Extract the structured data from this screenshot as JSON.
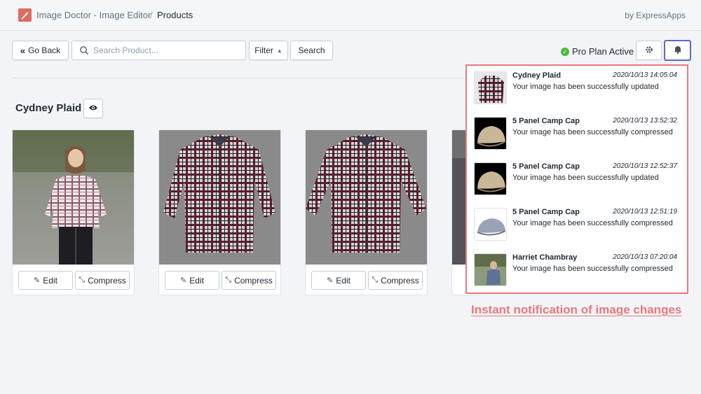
{
  "header": {
    "app_name": "Image Doctor - Image Editor",
    "separator": "/",
    "page": "Products",
    "by": "by ExpressApps"
  },
  "toolbar": {
    "go_back_label": "Go Back",
    "search_placeholder": "Search Product...",
    "search_value": "",
    "filter_label": "Filter",
    "search_button_label": "Search",
    "plan_status": "Pro Plan Active"
  },
  "product": {
    "title": "Cydney Plaid",
    "cards": [
      {
        "edit_label": "Edit",
        "compress_label": "Compress"
      },
      {
        "edit_label": "Edit",
        "compress_label": "Compress"
      },
      {
        "edit_label": "Edit",
        "compress_label": "Compress"
      }
    ]
  },
  "notifications": [
    {
      "name": "Cydney Plaid",
      "time": "2020/10/13 14:05:04",
      "message": "Your image has been successfully updated"
    },
    {
      "name": "5 Panel Camp Cap",
      "time": "2020/10/13 13:52:32",
      "message": "Your image has been successfully compressed"
    },
    {
      "name": "5 Panel Camp Cap",
      "time": "2020/10/13 12:52:37",
      "message": "Your image has been successfully updated"
    },
    {
      "name": "5 Panel Camp Cap",
      "time": "2020/10/13 12:51:19",
      "message": "Your image has been successfully compressed"
    },
    {
      "name": "Harriet Chambray",
      "time": "2020/10/13 07:20:04",
      "message": "Your image has been successfully compressed"
    }
  ],
  "caption": "Instant notification of image changes",
  "colors": {
    "accent": "#5c6ac4",
    "highlight": "#e9797a",
    "success": "#50b83c",
    "logo": "#de6b62"
  }
}
